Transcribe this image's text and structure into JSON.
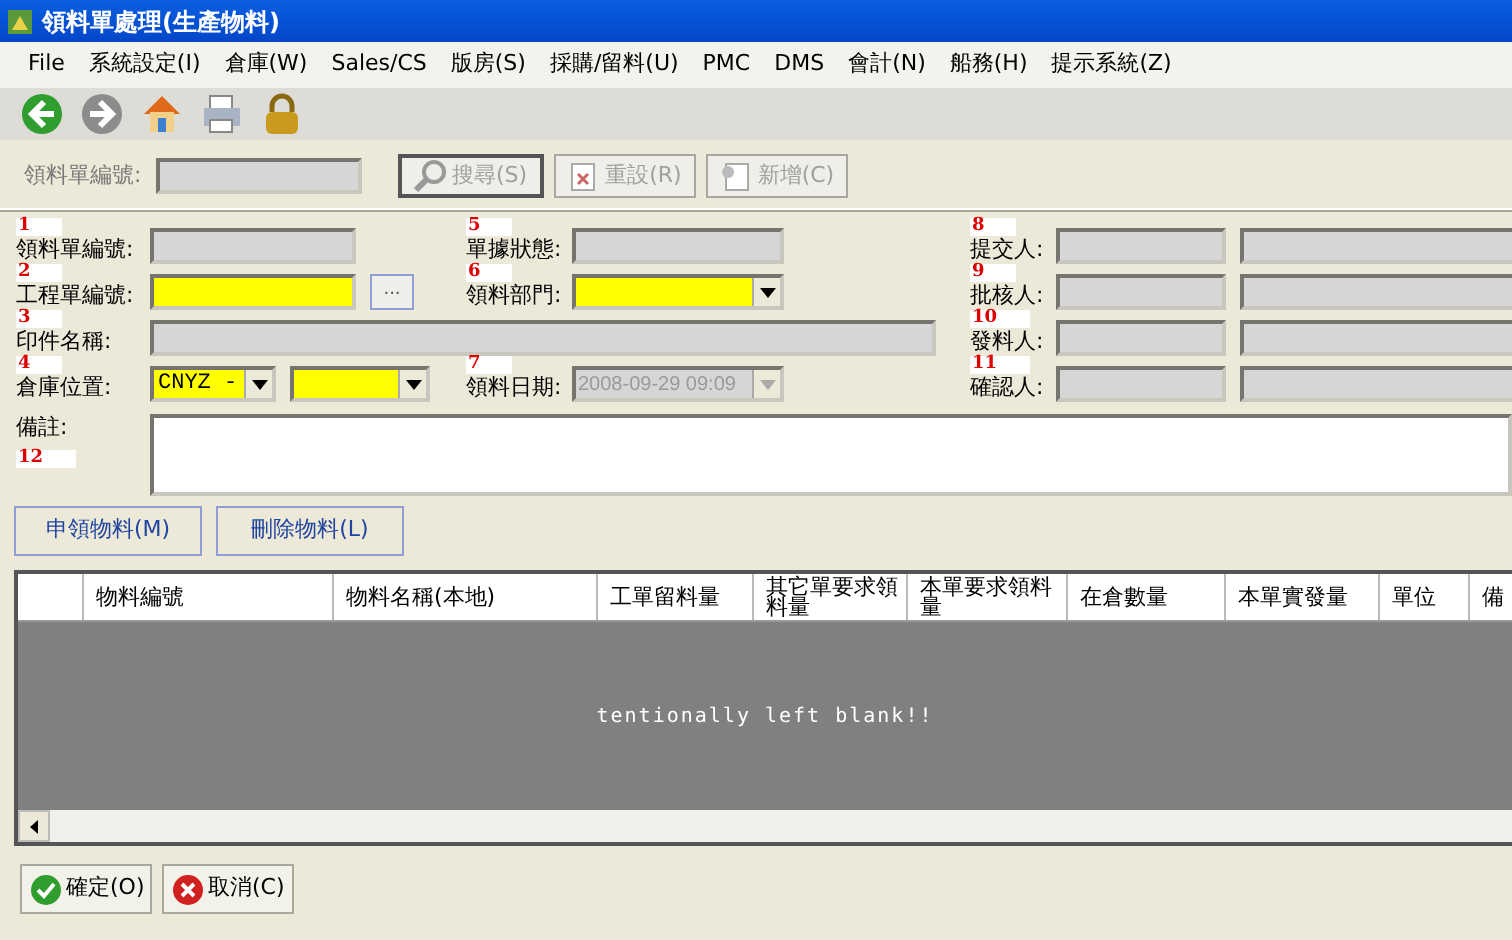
{
  "window": {
    "title": "領料單處理(生產物料)"
  },
  "menu": [
    {
      "label": "File"
    },
    {
      "label": "系統設定(I)"
    },
    {
      "label": "倉庫(W)"
    },
    {
      "label": "Sales/CS"
    },
    {
      "label": "版房(S)"
    },
    {
      "label": "採購/留料(U)"
    },
    {
      "label": "PMC"
    },
    {
      "label": "DMS"
    },
    {
      "label": "會計(N)"
    },
    {
      "label": "船務(H)"
    },
    {
      "label": "提示系統(Z)"
    }
  ],
  "toolbar": [
    {
      "kind": "back",
      "disabled": false
    },
    {
      "kind": "forward",
      "disabled": true
    },
    {
      "kind": "home",
      "disabled": false
    },
    {
      "kind": "print",
      "disabled": false
    },
    {
      "kind": "lock",
      "disabled": false
    }
  ],
  "search": {
    "label": "領料單編號:",
    "field_disabled": true,
    "buttons": [
      {
        "kind": "search",
        "label": "搜尋(S)",
        "disabled": true
      },
      {
        "kind": "reset",
        "label": "重設(R)",
        "disabled": true
      },
      {
        "kind": "new",
        "label": "新增(C)",
        "disabled": true
      }
    ]
  },
  "form": {
    "rows": [
      {
        "left": {
          "label": "領料單編號:",
          "marker": "1",
          "controls": [
            {
              "kind": "text",
              "disabled": true,
              "required": false
            }
          ]
        },
        "mid": {
          "label": "單據狀態:",
          "marker": "5",
          "controls": [
            {
              "kind": "text",
              "disabled": true,
              "required": false
            }
          ]
        },
        "right": {
          "label": "提交人:",
          "marker": "8",
          "controls": [
            {
              "kind": "text",
              "disabled": true,
              "required": false
            },
            {
              "kind": "text",
              "disabled": true,
              "required": false
            }
          ]
        }
      },
      {
        "left": {
          "label": "工程單編號:",
          "marker": "2",
          "controls": [
            {
              "kind": "text",
              "disabled": false,
              "required": true
            },
            {
              "kind": "ellipsis",
              "label": "..."
            }
          ]
        },
        "mid": {
          "label": "領料部門:",
          "marker": "6",
          "controls": [
            {
              "kind": "combo",
              "disabled": false,
              "required": true
            }
          ]
        },
        "right": {
          "label": "批核人:",
          "marker": "9",
          "controls": [
            {
              "kind": "text",
              "disabled": true,
              "required": false
            },
            {
              "kind": "text",
              "disabled": true,
              "required": false
            }
          ]
        }
      },
      {
        "left": {
          "label": "印件名稱:",
          "marker": "3",
          "controls": [
            {
              "kind": "wide",
              "disabled": true,
              "required": false
            }
          ]
        },
        "right": {
          "label": "發料人:",
          "marker": "10",
          "controls": [
            {
              "kind": "text",
              "disabled": true,
              "required": false
            },
            {
              "kind": "text",
              "disabled": true,
              "required": false
            }
          ]
        }
      },
      {
        "left": {
          "label": "倉庫位置:",
          "marker": "4",
          "controls": [
            {
              "kind": "combo",
              "disabled": false,
              "required": true,
              "value": "CNYZ -"
            },
            {
              "kind": "combo",
              "disabled": false,
              "required": true
            }
          ]
        },
        "mid": {
          "label": "領料日期:",
          "marker": "7",
          "controls": [
            {
              "kind": "combo",
              "disabled": true,
              "required": false,
              "value": "2008-09-29 09:09"
            }
          ]
        },
        "right": {
          "label": "確認人:",
          "marker": "11",
          "controls": [
            {
              "kind": "text",
              "disabled": true,
              "required": false
            },
            {
              "kind": "text",
              "disabled": true,
              "required": false
            }
          ]
        }
      }
    ]
  },
  "remarks": {
    "label": "備註:",
    "marker": "12"
  },
  "item_buttons": [
    {
      "label": "申領物料(M)"
    },
    {
      "label": "刪除物料(L)"
    }
  ],
  "grid": {
    "columns": [
      "物料編號",
      "物料名稱(本地)",
      "工單留料量",
      "其它單要求領料量",
      "本單要求領料量",
      "在倉數量",
      "本單實發量",
      "單位",
      "備"
    ],
    "empty_text": "tentionally left blank!!"
  },
  "footer_buttons": [
    {
      "kind": "ok",
      "label": "確定(O)"
    },
    {
      "kind": "cancel",
      "label": "取消(C)"
    }
  ]
}
